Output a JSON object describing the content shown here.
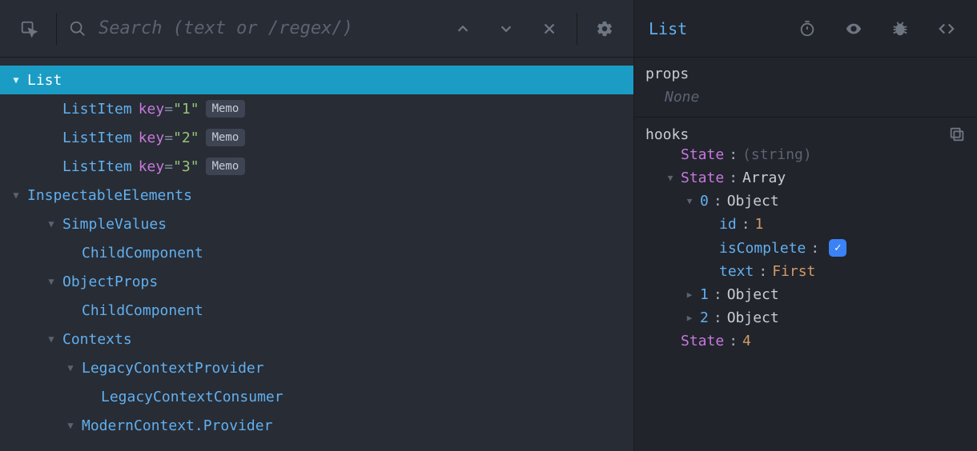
{
  "search": {
    "placeholder": "Search (text or /regex/)"
  },
  "tree": [
    {
      "name": "List",
      "depth": 1,
      "expandable": true,
      "open": true,
      "selected": true
    },
    {
      "name": "ListItem",
      "depth": 2,
      "key": "1",
      "badge": "Memo"
    },
    {
      "name": "ListItem",
      "depth": 2,
      "key": "2",
      "badge": "Memo"
    },
    {
      "name": "ListItem",
      "depth": 2,
      "key": "3",
      "badge": "Memo"
    },
    {
      "name": "InspectableElements",
      "depth": 1,
      "expandable": true,
      "open": true
    },
    {
      "name": "SimpleValues",
      "depth": 2,
      "expandable": true,
      "open": true
    },
    {
      "name": "ChildComponent",
      "depth": 3
    },
    {
      "name": "ObjectProps",
      "depth": 2,
      "expandable": true,
      "open": true
    },
    {
      "name": "ChildComponent",
      "depth": 3
    },
    {
      "name": "Contexts",
      "depth": 2,
      "expandable": true,
      "open": true
    },
    {
      "name": "LegacyContextProvider",
      "depth": 3,
      "expandable": true,
      "open": true
    },
    {
      "name": "LegacyContextConsumer",
      "depth": 4
    },
    {
      "name": "ModernContext.Provider",
      "depth": 3,
      "expandable": true,
      "open": true
    }
  ],
  "detail": {
    "title": "List",
    "sections": {
      "props": {
        "label": "props",
        "none": "None"
      },
      "hooks": {
        "label": "hooks",
        "lines": [
          {
            "indent": 1,
            "arrow": "",
            "key": "State",
            "sep": ":",
            "val": "(string)",
            "valClass": "hv-type"
          },
          {
            "indent": 1,
            "arrow": "down",
            "key": "State",
            "sep": ":",
            "val": "Array",
            "valClass": "hv-arr"
          },
          {
            "indent": 2,
            "arrow": "down",
            "key": "0",
            "keyClass": "hv-key",
            "sep": ":",
            "val": "Object",
            "valClass": "hv-arr"
          },
          {
            "indent": 3,
            "arrow": "",
            "key": "id",
            "keyClass": "hv-key",
            "sep": ":",
            "val": "1",
            "valClass": "hv-num"
          },
          {
            "indent": 3,
            "arrow": "",
            "key": "isComplete",
            "keyClass": "hv-key",
            "sep": ":",
            "checkbox": true
          },
          {
            "indent": 3,
            "arrow": "",
            "key": "text",
            "keyClass": "hv-key",
            "sep": ":",
            "val": "First",
            "valClass": "hv-str"
          },
          {
            "indent": 2,
            "arrow": "right",
            "key": "1",
            "keyClass": "hv-key",
            "sep": ":",
            "val": "Object",
            "valClass": "hv-arr"
          },
          {
            "indent": 2,
            "arrow": "right",
            "key": "2",
            "keyClass": "hv-key",
            "sep": ":",
            "val": "Object",
            "valClass": "hv-arr"
          },
          {
            "indent": 1,
            "arrow": "",
            "key": "State",
            "sep": ":",
            "val": "4",
            "valClass": "hv-num"
          }
        ]
      }
    }
  }
}
